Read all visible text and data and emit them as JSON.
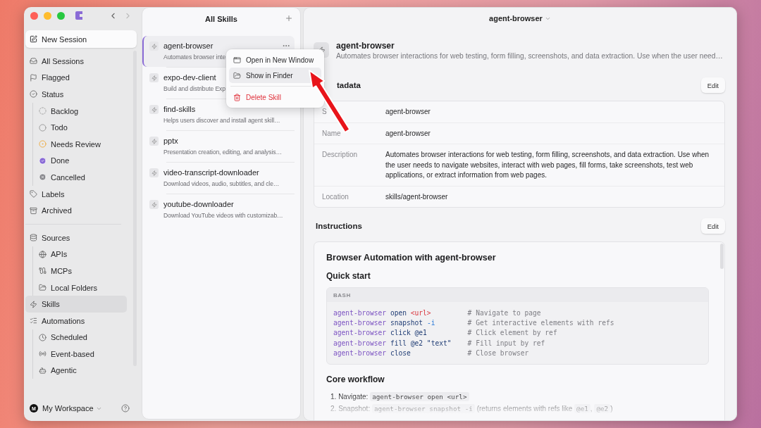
{
  "sidebar": {
    "new_session": "New Session",
    "sections": [
      {
        "items": [
          {
            "kind": "inbox",
            "label": "All Sessions",
            "selected": false
          },
          {
            "kind": "flag",
            "label": "Flagged",
            "selected": false
          },
          {
            "kind": "status",
            "label": "Status",
            "selected": false,
            "children": [
              {
                "kind": "backlog",
                "label": "Backlog",
                "selected": false
              },
              {
                "kind": "todo",
                "label": "Todo",
                "selected": false
              },
              {
                "kind": "review",
                "label": "Needs Review",
                "selected": false
              },
              {
                "kind": "done",
                "label": "Done",
                "selected": false
              },
              {
                "kind": "cancelled",
                "label": "Cancelled",
                "selected": false
              }
            ]
          },
          {
            "kind": "tag",
            "label": "Labels",
            "selected": false
          },
          {
            "kind": "archive",
            "label": "Archived",
            "selected": false
          }
        ]
      },
      {
        "items": [
          {
            "kind": "database",
            "label": "Sources",
            "selected": false,
            "children": [
              {
                "kind": "globe",
                "label": "APIs",
                "selected": false
              },
              {
                "kind": "mcp",
                "label": "MCPs",
                "selected": false
              },
              {
                "kind": "folder",
                "label": "Local Folders",
                "selected": false
              }
            ]
          },
          {
            "kind": "bolt",
            "label": "Skills",
            "selected": true
          },
          {
            "kind": "list",
            "label": "Automations",
            "selected": false,
            "children": [
              {
                "kind": "clock",
                "label": "Scheduled",
                "selected": false
              },
              {
                "kind": "radio",
                "label": "Event-based",
                "selected": false
              },
              {
                "kind": "bot",
                "label": "Agentic",
                "selected": false
              }
            ]
          }
        ]
      }
    ],
    "workspace": {
      "avatar": "M",
      "label": "My Workspace"
    }
  },
  "skills_panel": {
    "title": "All Skills",
    "items": [
      {
        "name": "agent-browser",
        "description": "Automates browser inte",
        "selected": true
      },
      {
        "name": "expo-dev-client",
        "description": "Build and distribute Exp",
        "selected": false
      },
      {
        "name": "find-skills",
        "description": "Helps users discover and install agent skill…",
        "selected": false
      },
      {
        "name": "pptx",
        "description": "Presentation creation, editing, and analysis…",
        "selected": false
      },
      {
        "name": "video-transcript-downloader",
        "description": "Download videos, audio, subtitles, and cle…",
        "selected": false
      },
      {
        "name": "youtube-downloader",
        "description": "Download YouTube videos with customizab…",
        "selected": false
      }
    ]
  },
  "context_menu": {
    "items": [
      {
        "kind": "window",
        "label": "Open in New Window",
        "selected": false
      },
      {
        "kind": "folder",
        "label": "Show in Finder",
        "selected": true
      },
      {
        "kind": "delete",
        "label": "Delete Skill",
        "selected": false
      }
    ]
  },
  "detail": {
    "header_title": "agent-browser",
    "skill": {
      "name": "agent-browser",
      "description": "Automates browser interactions for web testing, form filling, screenshots, and data extraction. Use when the user need…"
    },
    "metadata": {
      "heading": "tadata",
      "edit": "Edit",
      "rows": [
        {
          "label": "S",
          "value": "agent-browser"
        },
        {
          "label": "Name",
          "value": "agent-browser"
        },
        {
          "label": "Description",
          "value": "Automates browser interactions for web testing, form filling, screenshots, and data extraction. Use when the user needs to navigate websites, interact with web pages, fill forms, take screenshots, test web applications, or extract information from web pages."
        },
        {
          "label": "Location",
          "value": "skills/agent-browser"
        }
      ]
    },
    "instructions": {
      "heading": "Instructions",
      "edit": "Edit",
      "title": "Browser Automation with agent-browser",
      "sections": [
        {
          "heading": "Quick start",
          "code": {
            "language": "BASH",
            "lines": [
              {
                "tokens": [
                  {
                    "kind": "cmd",
                    "text": "agent-browser"
                  },
                  {
                    "kind": "word",
                    "text": "open"
                  },
                  {
                    "kind": "angle",
                    "text": "<url>"
                  }
                ],
                "comment": "# Navigate to page"
              },
              {
                "tokens": [
                  {
                    "kind": "cmd",
                    "text": "agent-browser"
                  },
                  {
                    "kind": "word",
                    "text": "snapshot"
                  },
                  {
                    "kind": "flag",
                    "text": "-i"
                  }
                ],
                "comment": "# Get interactive elements with refs"
              },
              {
                "tokens": [
                  {
                    "kind": "cmd",
                    "text": "agent-browser"
                  },
                  {
                    "kind": "word",
                    "text": "click @e1"
                  }
                ],
                "comment": "# Click element by ref"
              },
              {
                "tokens": [
                  {
                    "kind": "cmd",
                    "text": "agent-browser"
                  },
                  {
                    "kind": "word",
                    "text": "fill @e2 \"text\""
                  }
                ],
                "comment": "# Fill input by ref"
              },
              {
                "tokens": [
                  {
                    "kind": "cmd",
                    "text": "agent-browser"
                  },
                  {
                    "kind": "word",
                    "text": "close"
                  }
                ],
                "comment": "# Close browser"
              }
            ]
          }
        },
        {
          "heading": "Core workflow",
          "steps": [
            {
              "number": "1.",
              "parts": [
                {
                  "kind": "text",
                  "text": "Navigate: "
                },
                {
                  "kind": "code",
                  "text": "agent-browser open <url>"
                }
              ]
            },
            {
              "number": "2.",
              "parts": [
                {
                  "kind": "text",
                  "text": "Snapshot: "
                },
                {
                  "kind": "code",
                  "text": "agent-browser snapshot -i"
                },
                {
                  "kind": "text",
                  "text": " (returns elements with refs like "
                },
                {
                  "kind": "code",
                  "text": "@e1"
                },
                {
                  "kind": "text",
                  "text": ", "
                },
                {
                  "kind": "code",
                  "text": "@e2"
                },
                {
                  "kind": "text",
                  "text": ")"
                }
              ]
            }
          ]
        }
      ]
    }
  }
}
